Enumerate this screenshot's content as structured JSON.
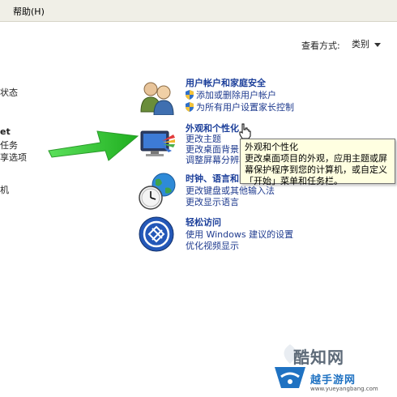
{
  "menubar": {
    "help": "帮助(H)"
  },
  "view_by": {
    "label": "查看方式:",
    "value": "类别"
  },
  "left_fragments": [
    "状态",
    "et",
    "任务",
    "享选项",
    "机"
  ],
  "categories": [
    {
      "title": "用户帐户和家庭安全",
      "links": [
        "添加或删除用户帐户",
        "为所有用户设置家长控制"
      ],
      "icon": "users-icon"
    },
    {
      "title": "外观和个性化",
      "links": [
        "更改主题",
        "更改桌面背景",
        "调整屏幕分辨率"
      ],
      "icon": "display-appearance-icon"
    },
    {
      "title": "时钟、语言和区域",
      "links": [
        "更改键盘或其他输入法",
        "更改显示语言"
      ],
      "icon": "clock-globe-icon"
    },
    {
      "title": "轻松访问",
      "links": [
        "使用 Windows 建议的设置",
        "优化视频显示"
      ],
      "icon": "ease-of-access-icon"
    }
  ],
  "tooltip": {
    "title": "外观和个性化",
    "body": "更改桌面项目的外观，应用主题或屏幕保护程序到您的计算机，或自定义「开始」菜单和任务栏。"
  },
  "watermark": {
    "name": "酷知网",
    "name2": "越手游网",
    "url": "www.yueyangbang.com"
  },
  "colors": {
    "link": "#1f3b8f",
    "title": "#1c3f9a",
    "tooltip_bg": "#ffffe1",
    "arrow": "#3cc83c"
  }
}
